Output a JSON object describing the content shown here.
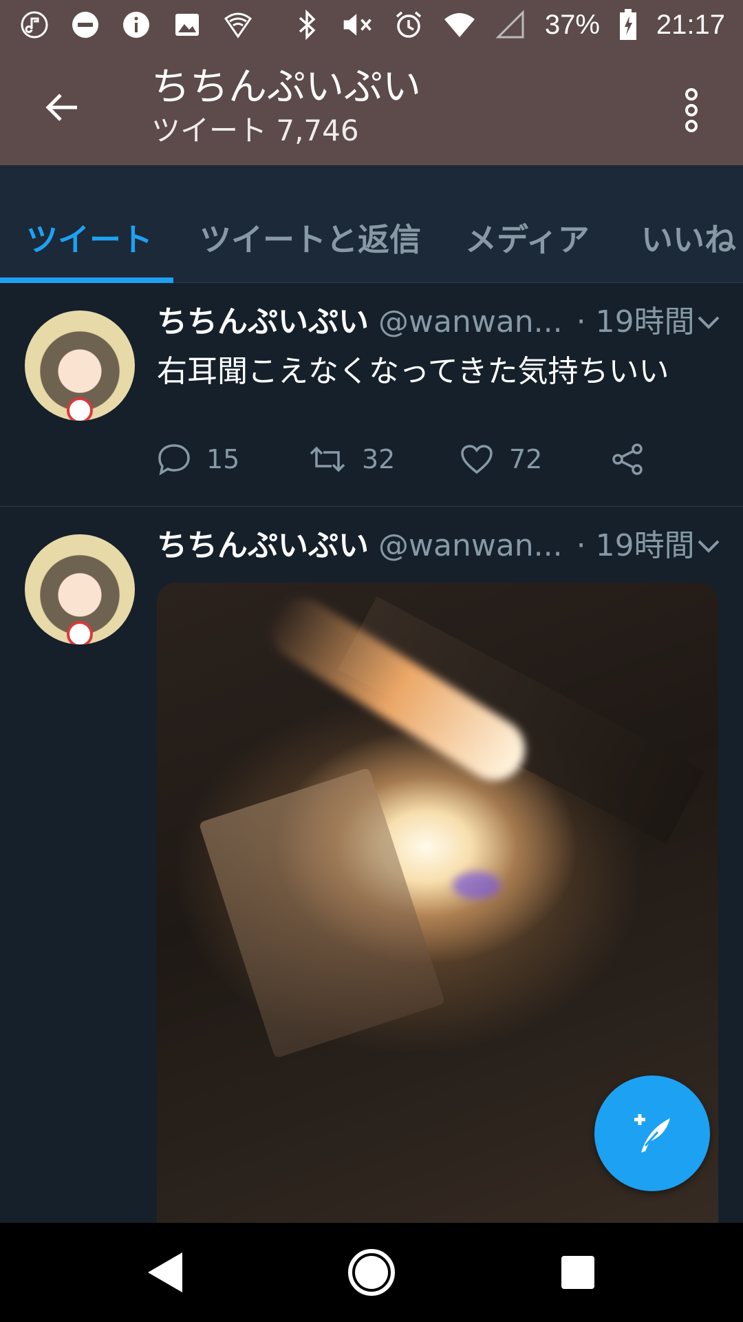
{
  "status_bar": {
    "left_icons": [
      "music-icon",
      "do-not-disturb-icon",
      "info-icon",
      "image-icon",
      "shield-wifi-icon"
    ],
    "right_icons": [
      "bluetooth-icon",
      "volume-mute-icon",
      "alarm-icon",
      "wifi-icon",
      "signal-icon"
    ],
    "battery": "37%",
    "time": "21:17"
  },
  "app_bar": {
    "title": "ちちんぷいぷい",
    "subtitle": "ツイート 7,746"
  },
  "tabs": [
    {
      "label": "ツイート",
      "active": true
    },
    {
      "label": "ツイートと返信",
      "active": false
    },
    {
      "label": "メディア",
      "active": false
    },
    {
      "label": "いいね",
      "active": false
    }
  ],
  "tweets": [
    {
      "name": "ちちんぷいぷい",
      "handle": "@wanwan...",
      "time": "· 19時間",
      "text": "右耳聞こえなくなってきた気持ちいい",
      "replies": "15",
      "retweets": "32",
      "likes": "72"
    },
    {
      "name": "ちちんぷいぷい",
      "handle": "@wanwan...",
      "time": "· 19時間",
      "text": ""
    }
  ],
  "colors": {
    "accent": "#1da1f2",
    "background": "#15202b",
    "header": "#5d4b4b"
  }
}
